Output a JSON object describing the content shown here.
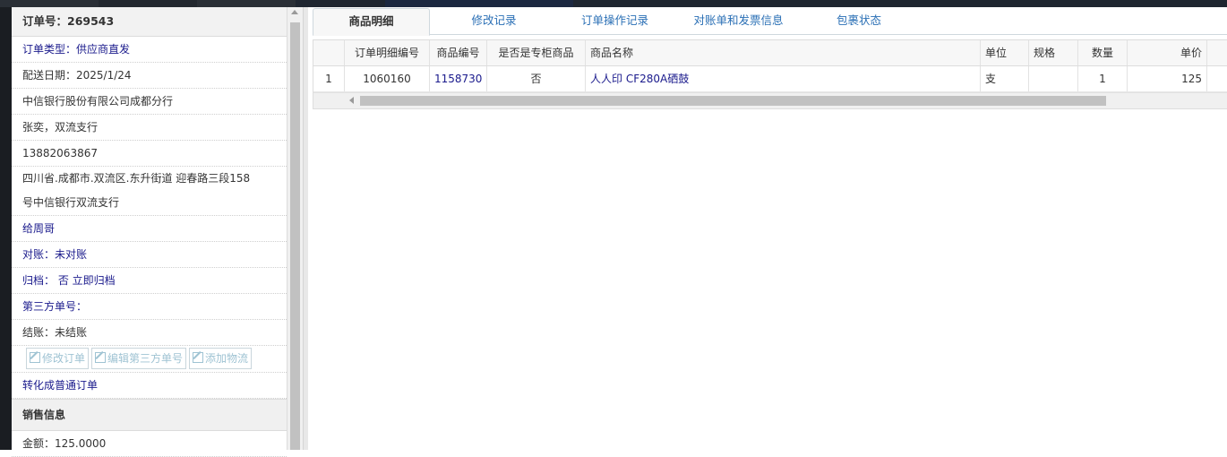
{
  "order": {
    "header": "订单号：269543",
    "type": "订单类型：供应商直发",
    "delivery_date": "配送日期：2025/1/24",
    "company": "中信银行股份有限公司成都分行",
    "contact": "张奕，双流支行",
    "phone": "13882063867",
    "address_line1": "四川省.成都市.双流区.东升街道 迎春路三段158",
    "address_line2": "号中信银行双流支行",
    "assignee": "给周哥",
    "reconcile": "对账：未对账",
    "archive": "归档： 否 立即归档",
    "third_party": "第三方单号：",
    "settlement": "结账：未结账",
    "buttons": {
      "edit_order": "修改订单",
      "edit_third_party": "编辑第三方单号",
      "add_logistics": "添加物流"
    },
    "convert": "转化成普通订单"
  },
  "sales": {
    "header": "销售信息",
    "amount": "金额：125.0000"
  },
  "tabs": [
    "商品明细",
    "修改记录",
    "订单操作记录",
    "对账单和发票信息",
    "包裹状态"
  ],
  "grid": {
    "headers": [
      "",
      "订单明细编号",
      "商品编号",
      "是否是专柜商品",
      "商品名称",
      "单位",
      "规格",
      "数量",
      "单价"
    ],
    "row": [
      "1",
      "1060160",
      "1158730",
      "否",
      "人人印 CF280A硒鼓",
      "支",
      "",
      "1",
      "125"
    ]
  },
  "colors": {
    "link": "#1a1a8c",
    "tab_link": "#2a6fb5",
    "dark_bg": "#1a1d22"
  }
}
